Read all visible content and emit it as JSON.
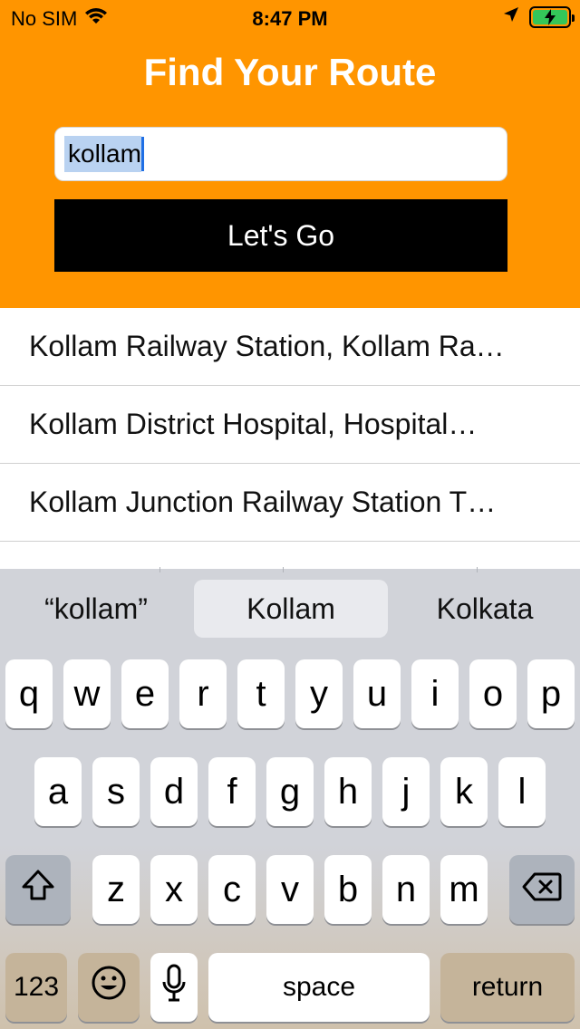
{
  "status": {
    "carrier": "No SIM",
    "time": "8:47 PM"
  },
  "page": {
    "title": "Find Your Route"
  },
  "search": {
    "value": "kollam"
  },
  "button": {
    "label": "Let's Go"
  },
  "results": [
    "Kollam Railway Station, Kollam Ra…",
    "Kollam District Hospital, Hospital…",
    "Kollam Junction Railway Station T…"
  ],
  "keyboard": {
    "suggestions": [
      "“kollam”",
      "Kollam",
      "Kolkata"
    ],
    "row1": [
      "q",
      "w",
      "e",
      "r",
      "t",
      "y",
      "u",
      "i",
      "o",
      "p"
    ],
    "row2": [
      "a",
      "s",
      "d",
      "f",
      "g",
      "h",
      "j",
      "k",
      "l"
    ],
    "row3": [
      "z",
      "x",
      "c",
      "v",
      "b",
      "n",
      "m"
    ],
    "numbers_label": "123",
    "space_label": "space",
    "return_label": "return"
  },
  "colors": {
    "header": "#FF9500",
    "button": "#000000",
    "battery": "#34C759"
  }
}
